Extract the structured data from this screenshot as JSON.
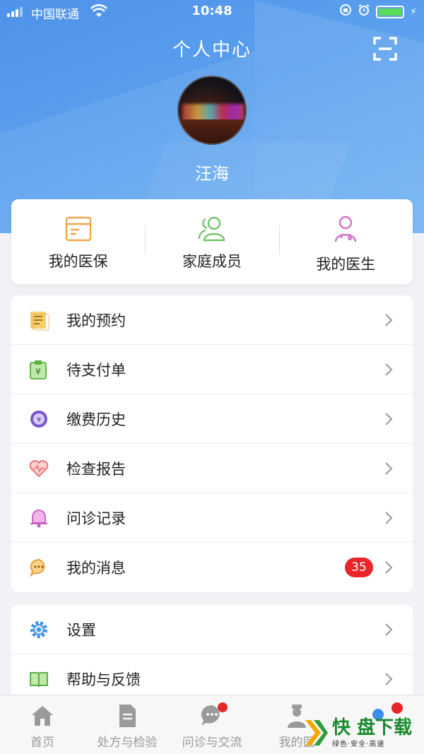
{
  "status_bar": {
    "carrier": "中国联通",
    "time": "10:48"
  },
  "header": {
    "title": "个人中心",
    "user_name": "汪海"
  },
  "quick_actions": [
    {
      "label": "我的医保",
      "icon": "medical-card-icon"
    },
    {
      "label": "家庭成员",
      "icon": "family-members-icon"
    },
    {
      "label": "我的医生",
      "icon": "doctor-icon"
    }
  ],
  "menu_group_1": [
    {
      "label": "我的预约",
      "icon": "appointment-icon"
    },
    {
      "label": "待支付单",
      "icon": "pending-payment-icon"
    },
    {
      "label": "缴费历史",
      "icon": "payment-history-icon"
    },
    {
      "label": "检查报告",
      "icon": "exam-report-icon"
    },
    {
      "label": "问诊记录",
      "icon": "consultation-record-icon"
    },
    {
      "label": "我的消息",
      "icon": "messages-icon",
      "badge": "35"
    }
  ],
  "menu_group_2": [
    {
      "label": "设置",
      "icon": "settings-icon"
    },
    {
      "label": "帮助与反馈",
      "icon": "help-feedback-icon"
    }
  ],
  "tab_bar": [
    {
      "label": "首页",
      "icon": "home-icon"
    },
    {
      "label": "处方与检验",
      "icon": "prescription-icon"
    },
    {
      "label": "问诊与交流",
      "icon": "chat-icon"
    },
    {
      "label": "我的医",
      "icon": "doctor-profile-icon"
    },
    {
      "label": "",
      "icon": "me-icon"
    }
  ],
  "watermark": {
    "main": "快 盘下载",
    "sub": "绿色·安全·高速"
  },
  "colors": {
    "header_blue": "#4f92ea",
    "badge_red": "#e8262a",
    "battery_green": "#5bdc55"
  }
}
